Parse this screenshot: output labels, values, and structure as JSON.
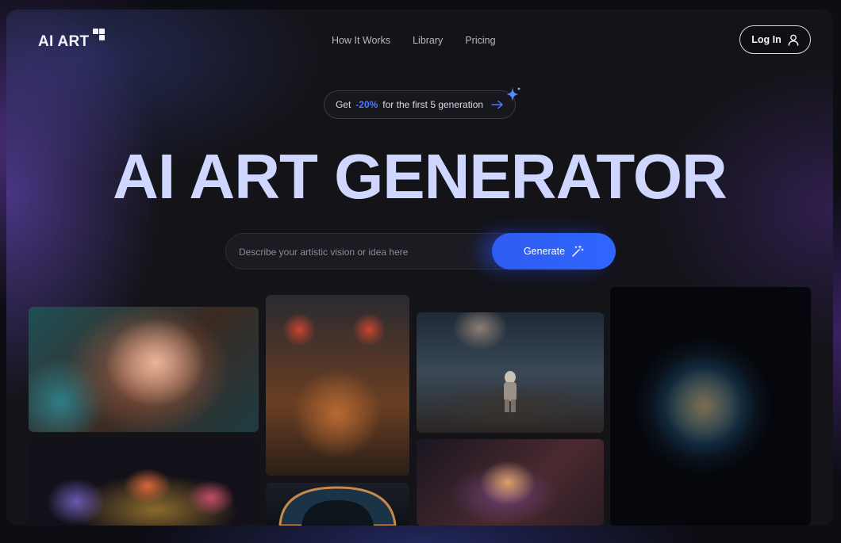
{
  "brand": {
    "name": "AI ART"
  },
  "nav": [
    {
      "label": "How It Works"
    },
    {
      "label": "Library"
    },
    {
      "label": "Pricing"
    }
  ],
  "header": {
    "login_label": "Log In",
    "login_icon": "user-icon"
  },
  "promo": {
    "prefix": "Get",
    "highlight": "-20%",
    "suffix": "for the first 5 generation",
    "icon": "arrow-right-icon",
    "accent": "#4a7bff"
  },
  "hero": {
    "title": "AI ART GENERATOR",
    "title_color": "#cfd6ff"
  },
  "search": {
    "placeholder": "Describe your artistic vision or idea here",
    "value": "",
    "button_label": "Generate",
    "button_icon": "magic-wand-icon",
    "button_color": "#2f5cf0"
  },
  "gallery": [
    {
      "subject": "portrait-woman-water"
    },
    {
      "subject": "cat-with-goggles"
    },
    {
      "subject": "astronaut-on-planet"
    },
    {
      "subject": "glowing-earth"
    },
    {
      "subject": "flower-wreath"
    },
    {
      "subject": "robot-helmet"
    },
    {
      "subject": "abstract-sculpture"
    }
  ]
}
